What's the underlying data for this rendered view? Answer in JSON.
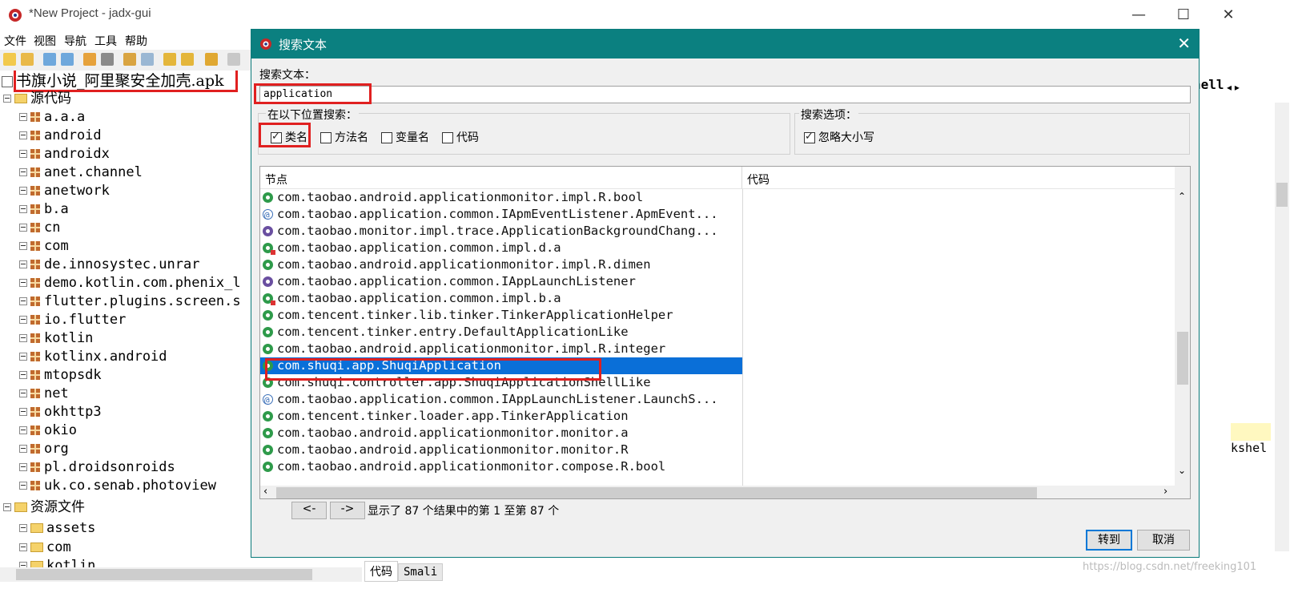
{
  "window": {
    "title": "*New Project - jadx-gui",
    "menu": [
      "文件",
      "视图",
      "导航",
      "工具",
      "帮助"
    ],
    "controls": [
      "—",
      "☐",
      "✕"
    ]
  },
  "tree": {
    "root": "书旗小说_阿里聚安全加壳.apk",
    "source_label": "源代码",
    "packages": [
      "a.a.a",
      "android",
      "androidx",
      "anet.channel",
      "anetwork",
      "b.a",
      "cn",
      "com",
      "de.innosystec.unrar",
      "demo.kotlin.com.phenix_l",
      "flutter.plugins.screen.s",
      "io.flutter",
      "kotlin",
      "kotlinx.android",
      "mtopsdk",
      "net",
      "okhttp3",
      "okio",
      "org",
      "pl.droidsonroids",
      "uk.co.senab.photoview"
    ],
    "resources_label": "资源文件",
    "resources": [
      "assets",
      "com",
      "kotlin"
    ]
  },
  "right_panel": {
    "tab_fragment": "hell",
    "code_fragment": "kshel",
    "tabs": [
      "代码",
      "Smali"
    ],
    "watermark": "https://blog.csdn.net/freeking101"
  },
  "dialog": {
    "title": "搜索文本",
    "search_label": "搜索文本：",
    "search_value": "application",
    "location_label": "在以下位置搜索：",
    "options_label": "搜索选项：",
    "checkboxes": {
      "class_name": {
        "label": "类名",
        "checked": true
      },
      "method_name": {
        "label": "方法名",
        "checked": false
      },
      "variable_name": {
        "label": "变量名",
        "checked": false
      },
      "code": {
        "label": "代码",
        "checked": false
      },
      "ignore_case": {
        "label": "忽略大小写",
        "checked": true
      }
    },
    "columns": [
      "节点",
      "代码"
    ],
    "results": [
      {
        "icon": "class",
        "text": "com.taobao.android.applicationmonitor.impl.R.bool"
      },
      {
        "icon": "annotation",
        "text": "com.taobao.application.common.IApmEventListener.ApmEvent..."
      },
      {
        "icon": "interface",
        "text": "com.taobao.monitor.impl.trace.ApplicationBackgroundChang..."
      },
      {
        "icon": "inner-class",
        "text": "com.taobao.application.common.impl.d.a"
      },
      {
        "icon": "class",
        "text": "com.taobao.android.applicationmonitor.impl.R.dimen"
      },
      {
        "icon": "interface",
        "text": "com.taobao.application.common.IAppLaunchListener"
      },
      {
        "icon": "inner-class",
        "text": "com.taobao.application.common.impl.b.a"
      },
      {
        "icon": "class",
        "text": "com.tencent.tinker.lib.tinker.TinkerApplicationHelper"
      },
      {
        "icon": "class",
        "text": "com.tencent.tinker.entry.DefaultApplicationLike"
      },
      {
        "icon": "class",
        "text": "com.taobao.android.applicationmonitor.impl.R.integer"
      },
      {
        "icon": "class",
        "text": "com.shuqi.app.ShuqiApplication",
        "selected": true
      },
      {
        "icon": "class",
        "text": "com.shuqi.controller.app.ShuqiApplicationShellLike"
      },
      {
        "icon": "annotation",
        "text": "com.taobao.application.common.IAppLaunchListener.LaunchS..."
      },
      {
        "icon": "class",
        "text": "com.tencent.tinker.loader.app.TinkerApplication"
      },
      {
        "icon": "class",
        "text": "com.taobao.android.applicationmonitor.monitor.a"
      },
      {
        "icon": "class",
        "text": "com.taobao.android.applicationmonitor.monitor.R"
      },
      {
        "icon": "class",
        "text": "com.taobao.android.applicationmonitor.compose.R.bool"
      }
    ],
    "prev_button": "<-",
    "next_button": "->",
    "status": "显示了 87 个结果中的第 1 至第 87 个",
    "goto_button": "转到",
    "cancel_button": "取消"
  },
  "colors": {
    "dialog_title_bg": "#0b8080",
    "selection": "#0a6fd8",
    "highlight_box": "#e02020"
  }
}
